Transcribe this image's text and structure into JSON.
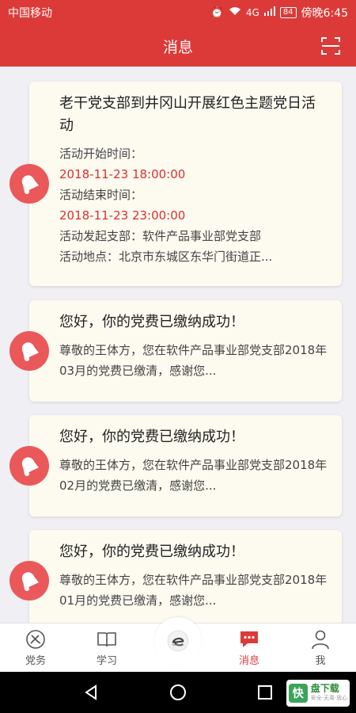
{
  "status_bar": {
    "carrier": "中国移动",
    "battery": "84",
    "signal": "4G",
    "time": "傍晚6:45"
  },
  "header": {
    "title": "消息",
    "scan_icon": "scan-icon"
  },
  "messages": [
    {
      "title": "老干党支部到井冈山开展红色主题党日活动",
      "lines": [
        {
          "text": "活动开始时间：",
          "highlight": false
        },
        {
          "text": "2018-11-23 18:00:00",
          "highlight": true
        },
        {
          "text": "活动结束时间：",
          "highlight": false
        },
        {
          "text": "2018-11-23 23:00:00",
          "highlight": true
        },
        {
          "text": "活动发起支部：软件产品事业部党支部",
          "highlight": false
        },
        {
          "text": "活动地点：北京市东城区东华门街道正...",
          "highlight": false
        }
      ]
    },
    {
      "title": "您好，你的党费已缴纳成功！",
      "body": "尊敬的王体方，您在软件产品事业部党支部2018年03月的党费已缴清，感谢您..."
    },
    {
      "title": "您好，你的党费已缴纳成功！",
      "body": "尊敬的王体方，您在软件产品事业部党支部2018年02月的党费已缴清，感谢您..."
    },
    {
      "title": "您好，你的党费已缴纳成功！",
      "body": "尊敬的王体方，您在软件产品事业部党支部2018年01月的党费已缴清，感谢您..."
    }
  ],
  "tabbar": {
    "items": [
      {
        "label": "党务",
        "icon": "party-emblem-icon",
        "active": false
      },
      {
        "label": "学习",
        "icon": "book-icon",
        "active": false
      },
      {
        "label": "",
        "icon": "center-logo-icon",
        "active": false
      },
      {
        "label": "消息",
        "icon": "message-icon",
        "active": true
      },
      {
        "label": "我",
        "icon": "person-icon",
        "active": false
      }
    ]
  },
  "watermark": {
    "logo_char": "快",
    "main": "盘下载",
    "sub": "安全·无毒·放心"
  },
  "colors": {
    "primary": "#dc3a38",
    "highlight_text": "#d9302d",
    "card_bg": "#fdfaf0",
    "bell_bg": "#ea5859"
  }
}
